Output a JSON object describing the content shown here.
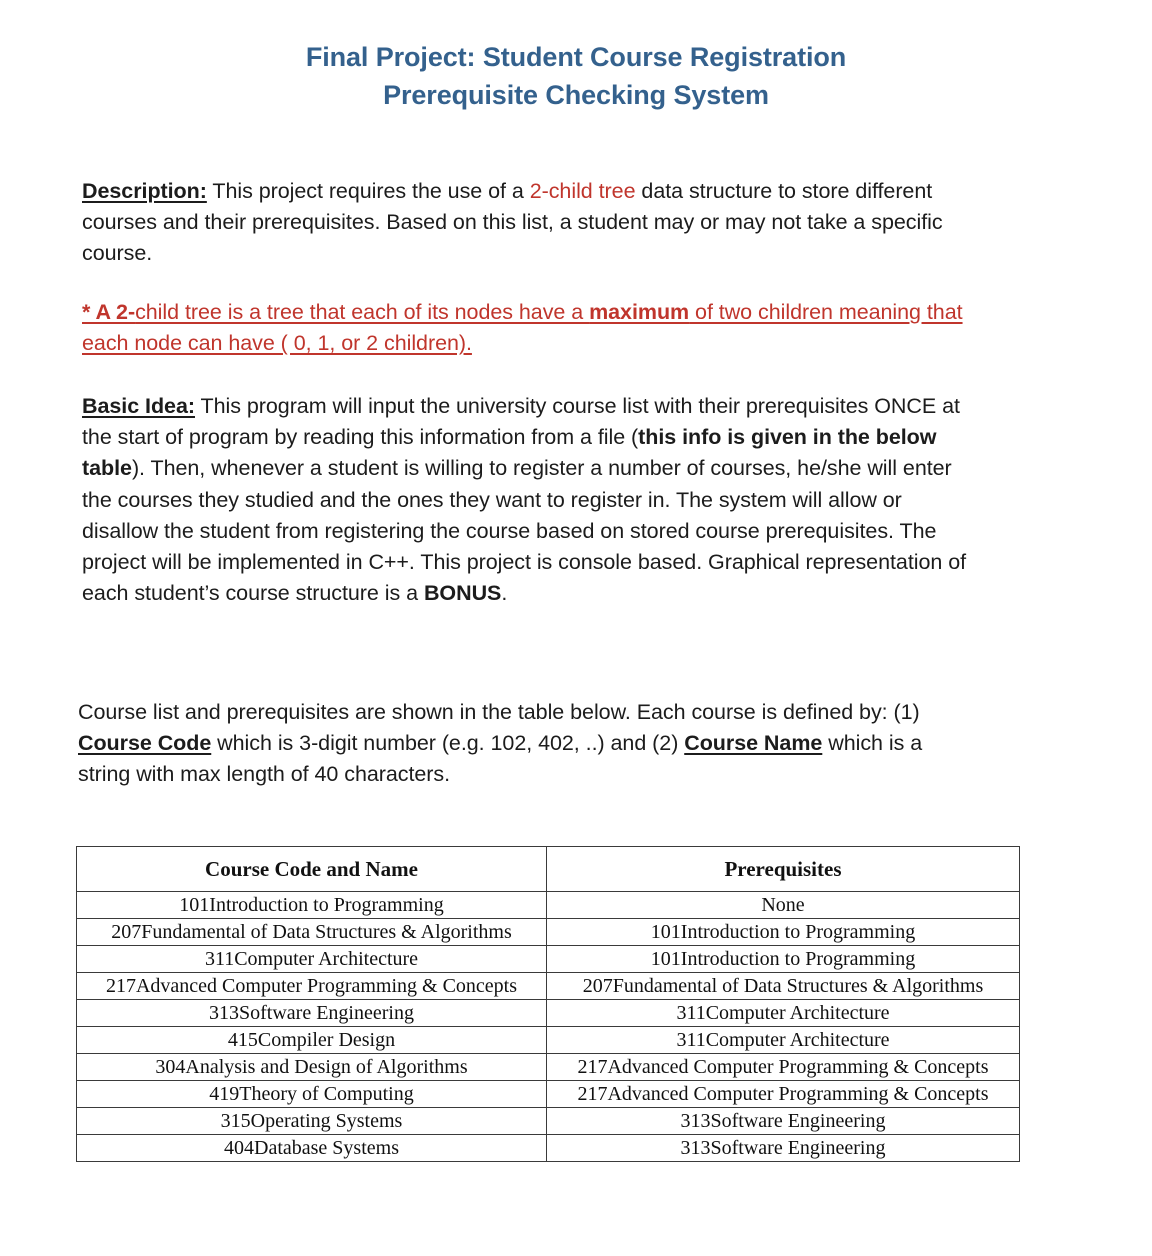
{
  "title": {
    "line1": "Final Project: Student Course Registration",
    "line2": "Prerequisite Checking System",
    "color": "#34618d"
  },
  "description": {
    "label": "Description:",
    "text_before_highlight": " This project requires the use of a ",
    "highlight": "2-child tree",
    "highlight_color": "#c0352c",
    "text_after_highlight": " data structure to store different courses and their prerequisites. Based on this list, a student may or may not take a specific course."
  },
  "note": {
    "color": "#c0352c",
    "bold_start": "* A 2-",
    "text_1": "child tree is a tree that each of its nodes have a ",
    "bold_maximum": "maximum",
    "text_2": " of two children meaning that each node can have ( 0, 1, or 2 children)."
  },
  "basic_idea": {
    "label": "Basic Idea:",
    "text_1": " This program will input the university course list with their prerequisites ONCE at the start of program by reading this information from a file (",
    "bold_1": "this info is given in the below table",
    "text_2": "). Then, whenever a student is willing to register a number of courses, he/she will enter the courses they studied and the ones they want to register in. The system will allow or disallow the student from registering the course based on stored course prerequisites. The project will be implemented in C++. This project is console based. Graphical representation of each student’s course structure is a ",
    "bold_bonus": "BONUS",
    "text_3": "."
  },
  "course_list_intro": {
    "text_1": "Course list and prerequisites are shown in the table below. Each course is defined by: (1) ",
    "bold_course_code": "Course Code",
    "text_2": " which is 3-digit number (e.g. 102, 402, ..) and (2) ",
    "bold_course_name": "Course Name",
    "text_3": " which is a string with max length of 40 characters."
  },
  "table": {
    "headers": [
      "Course Code and Name",
      "Prerequisites"
    ],
    "rows": [
      [
        "101Introduction to Programming",
        "None"
      ],
      [
        "207Fundamental of Data Structures & Algorithms",
        "101Introduction to Programming"
      ],
      [
        "311Computer Architecture",
        "101Introduction to Programming"
      ],
      [
        "217Advanced Computer Programming & Concepts",
        "207Fundamental of Data Structures & Algorithms"
      ],
      [
        "313Software Engineering",
        "311Computer Architecture"
      ],
      [
        "415Compiler Design",
        "311Computer Architecture"
      ],
      [
        "304Analysis and Design of Algorithms",
        "217Advanced Computer Programming & Concepts"
      ],
      [
        "419Theory of Computing",
        "217Advanced Computer Programming & Concepts"
      ],
      [
        "315Operating Systems",
        "313Software Engineering"
      ],
      [
        "404Database Systems",
        "313Software Engineering"
      ]
    ]
  }
}
